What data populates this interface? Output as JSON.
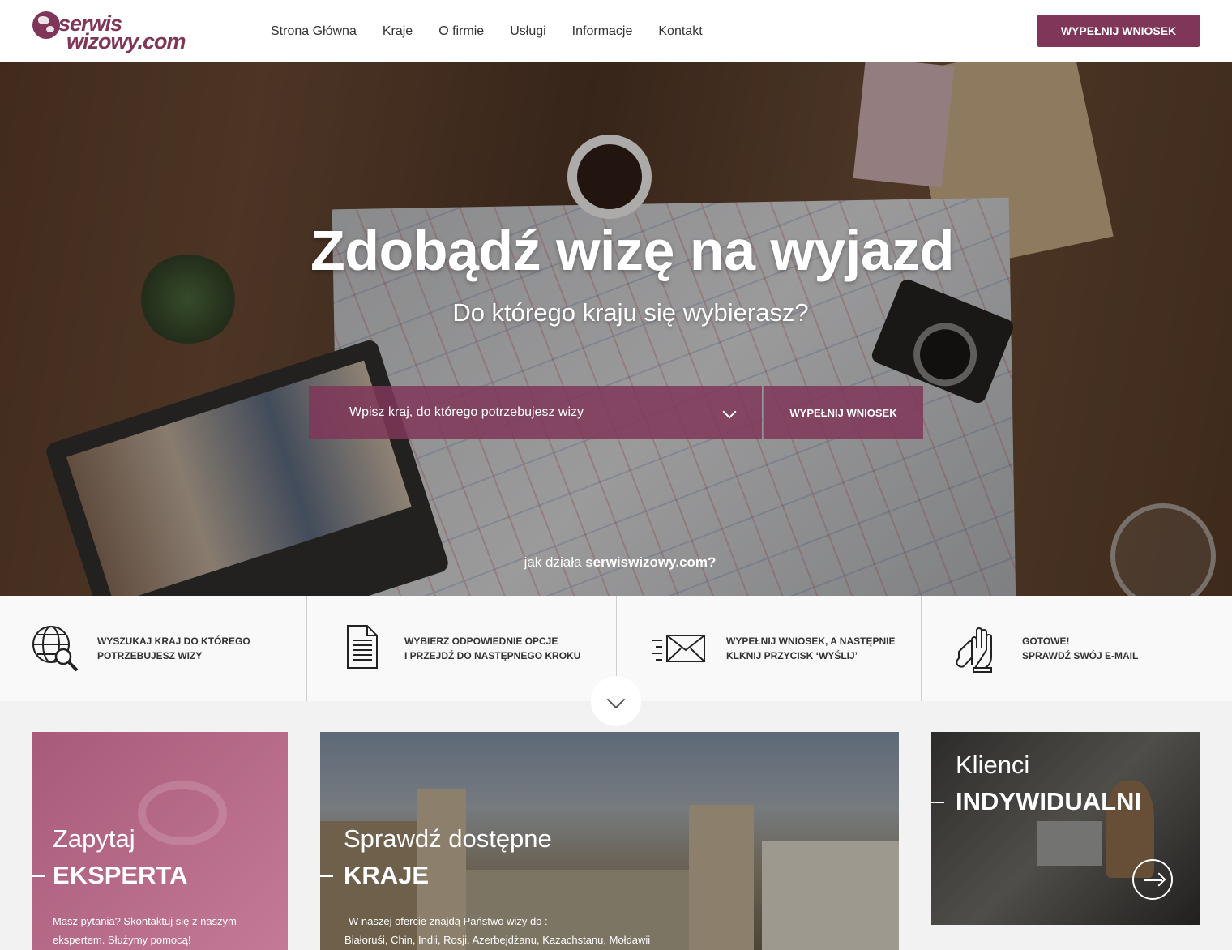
{
  "header": {
    "logo_line1": "serwis",
    "logo_line2": "wizowy.com",
    "nav": [
      "Strona Główna",
      "Kraje",
      "O firmie",
      "Usługi",
      "Informacje",
      "Kontakt"
    ],
    "cta": "WYPEŁNIJ WNIOSEK"
  },
  "hero": {
    "title": "Zdobądź wizę na wyjazd",
    "subtitle": "Do którego kraju się wybierasz?",
    "search_placeholder": "Wpisz kraj, do którego potrzebujesz wizy",
    "search_button": "WYPEŁNIJ WNIOSEK",
    "how_prefix": "jak działa ",
    "how_site": "serwiswizowy.com?"
  },
  "steps": [
    {
      "icon": "globe-search-icon",
      "line1": "WYSZUKAJ KRAJ DO KTÓREGO",
      "line2": "POTRZEBUJESZ WIZY"
    },
    {
      "icon": "document-icon",
      "line1": "WYBIERZ ODPOWIEDNIE OPCJE",
      "line2": "I PRZEJDŹ DO NASTĘPNEGO KROKU"
    },
    {
      "icon": "envelope-icon",
      "line1": "WYPEŁNIJ WNIOSEK, A NASTĘPNIE",
      "line2": "KLKNIJ PRZYCISK ‘WYŚLIJ’"
    },
    {
      "icon": "gloves-icon",
      "line1": "GOTOWE!",
      "line2": "SPRAWDŹ SWÓJ E-MAIL"
    }
  ],
  "cards": {
    "expert": {
      "title": "Zapytaj",
      "bold": "EKSPERTA",
      "body1": "Masz pytania?  Skontaktuj się z naszym",
      "body2": "ekspertem. Służymy pomocą!"
    },
    "countries": {
      "title": "Sprawdź dostępne",
      "bold": "KRAJE",
      "body1": "W naszej ofercie znajdą Państwo wizy do :",
      "body2": "Białoruśi, Chin, Indii, Rosji, Azerbejdżanu, Kazachstanu,  Mołdawii"
    },
    "clients": {
      "title": "Klienci",
      "bold": "INDYWIDUALNI"
    }
  },
  "colors": {
    "brand": "#7f3658",
    "accent_card": "#b46686"
  }
}
